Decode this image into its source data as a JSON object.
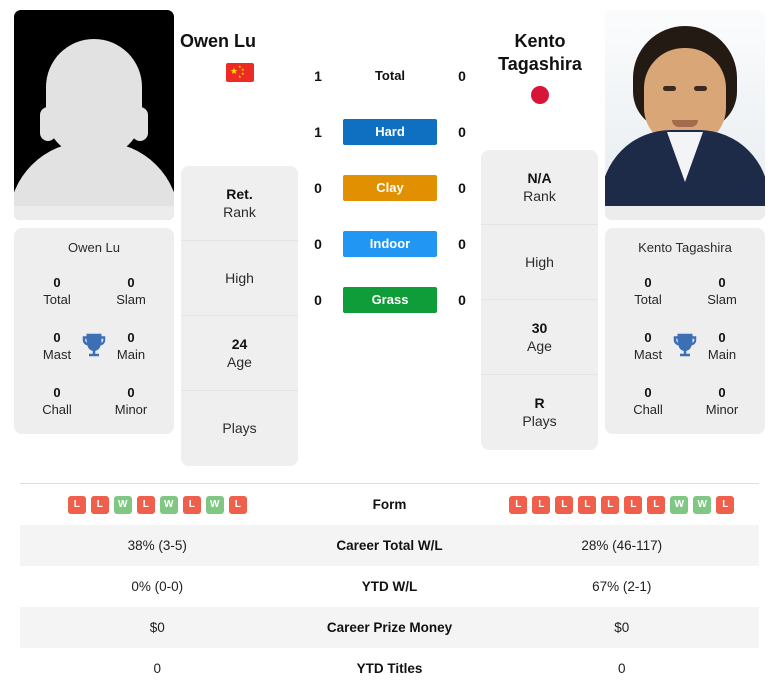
{
  "players": {
    "left": {
      "name": "Owen Lu",
      "card_name": "Owen Lu",
      "flag": "cn-flag-icon",
      "avatar": "silhouette-avatar-placeholder",
      "titles": [
        {
          "value": "0",
          "label": "Total"
        },
        {
          "value": "0",
          "label": "Slam"
        },
        {
          "value": "0",
          "label": "Mast"
        },
        {
          "value": "0",
          "label": "Main"
        },
        {
          "value": "0",
          "label": "Chall"
        },
        {
          "value": "0",
          "label": "Minor"
        }
      ],
      "info": [
        {
          "value": "Ret.",
          "label": "Rank"
        },
        {
          "value": "",
          "label": "High"
        },
        {
          "value": "24",
          "label": "Age"
        },
        {
          "value": "",
          "label": "Plays"
        }
      ]
    },
    "right": {
      "name": "Kento Tagashira",
      "name_line1": "Kento",
      "name_line2": "Tagashira",
      "card_name": "Kento Tagashira",
      "flag": "jp-flag-icon",
      "avatar": "player-photo",
      "titles": [
        {
          "value": "0",
          "label": "Total"
        },
        {
          "value": "0",
          "label": "Slam"
        },
        {
          "value": "0",
          "label": "Mast"
        },
        {
          "value": "0",
          "label": "Main"
        },
        {
          "value": "0",
          "label": "Chall"
        },
        {
          "value": "0",
          "label": "Minor"
        }
      ],
      "info": [
        {
          "value": "N/A",
          "label": "Rank"
        },
        {
          "value": "",
          "label": "High"
        },
        {
          "value": "30",
          "label": "Age"
        },
        {
          "value": "R",
          "label": "Plays"
        }
      ]
    }
  },
  "surfaces": [
    {
      "label": "Total",
      "left": "1",
      "right": "0",
      "color": "",
      "plain": true
    },
    {
      "label": "Hard",
      "left": "1",
      "right": "0",
      "color": "#0f6fc0",
      "plain": false
    },
    {
      "label": "Clay",
      "left": "0",
      "right": "0",
      "color": "#e09000",
      "plain": false
    },
    {
      "label": "Indoor",
      "left": "0",
      "right": "0",
      "color": "#2196f3",
      "plain": false
    },
    {
      "label": "Grass",
      "left": "0",
      "right": "0",
      "color": "#0f9d3a",
      "plain": false
    }
  ],
  "stats_table": {
    "rows": [
      {
        "label": "Form",
        "type": "form",
        "left_form": [
          "L",
          "L",
          "W",
          "L",
          "W",
          "L",
          "W",
          "L"
        ],
        "right_form": [
          "L",
          "L",
          "L",
          "L",
          "L",
          "L",
          "L",
          "W",
          "W",
          "L"
        ]
      },
      {
        "label": "Career Total W/L",
        "type": "text",
        "left": "38% (3-5)",
        "right": "28% (46-117)"
      },
      {
        "label": "YTD W/L",
        "type": "text",
        "left": "0% (0-0)",
        "right": "67% (2-1)"
      },
      {
        "label": "Career Prize Money",
        "type": "text",
        "left": "$0",
        "right": "$0"
      },
      {
        "label": "YTD Titles",
        "type": "text",
        "left": "0",
        "right": "0"
      }
    ]
  },
  "colors": {
    "win": "#81c784",
    "loss": "#ef5f4c",
    "hard": "#0f6fc0",
    "clay": "#e09000",
    "indoor": "#2196f3",
    "grass": "#0f9d3a",
    "trophy": "#3d6fb5"
  }
}
